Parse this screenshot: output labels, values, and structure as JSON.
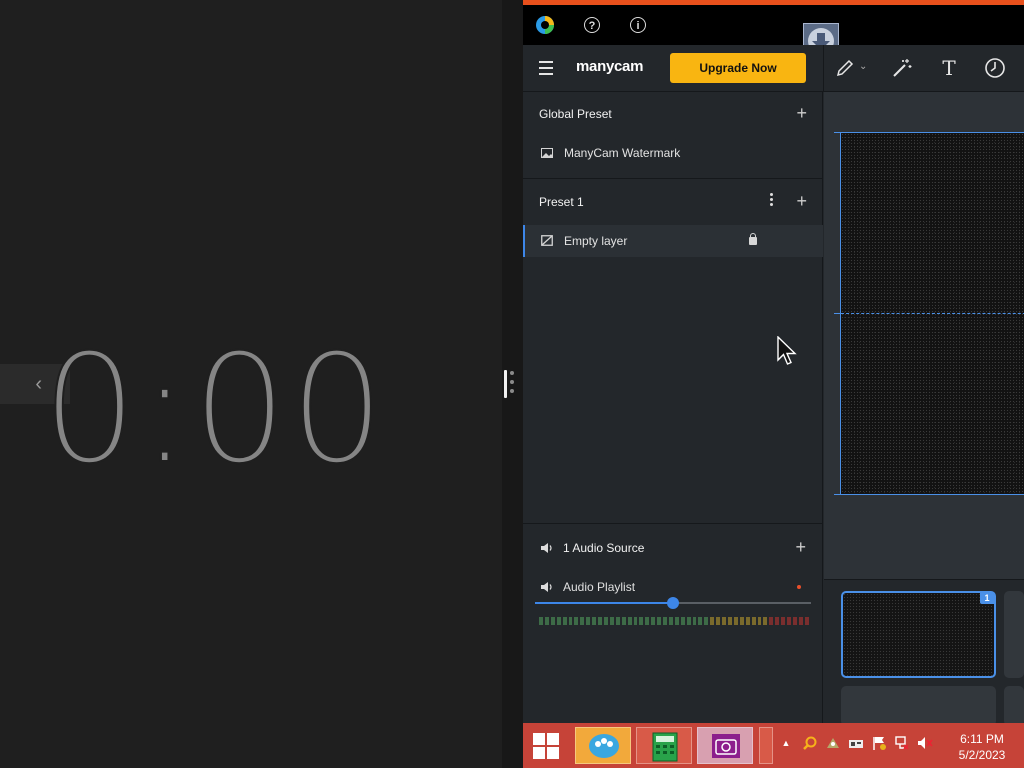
{
  "clock": {
    "time": "0:00",
    "back_icon": "chevron-left-icon"
  },
  "manycam": {
    "titlebar": {
      "logo_icon": "manycam-logo-icon",
      "help_icon": "help-circle-icon",
      "info_icon": "info-circle-icon",
      "help_glyph": "?",
      "info_glyph": "i"
    },
    "toolbar": {
      "brand": "manycam",
      "upgrade_label": "Upgrade Now",
      "tools": [
        "pencil-icon",
        "magic-wand-icon",
        "text-icon",
        "timer-icon"
      ],
      "text_tool_glyph": "T"
    },
    "layers": {
      "global_preset": {
        "title": "Global Preset",
        "items": [
          {
            "label": "ManyCam Watermark",
            "icon": "image-icon"
          }
        ]
      },
      "preset1": {
        "title": "Preset 1",
        "items": [
          {
            "label": "Empty layer",
            "icon": "empty-layer-icon",
            "locked": true
          }
        ]
      }
    },
    "audio": {
      "title": "1 Audio Source",
      "items": [
        {
          "label": "Audio Playlist",
          "volume": 0.5
        }
      ]
    },
    "preview": {
      "thumbnail_badge": "1"
    },
    "accent_color": "#3d86e8",
    "upgrade_color": "#f9b511"
  },
  "taskbar": {
    "apps": [
      "windows-start-icon",
      "meeting-app-icon",
      "calculator-icon",
      "camera-app-icon"
    ],
    "tray_icons": [
      "show-hidden-icons-chevron",
      "search-icon",
      "app-tray-icon",
      "network-card-icon",
      "action-center-flag-icon",
      "network-icon",
      "volume-muted-icon"
    ],
    "time": "6:11 PM",
    "date": "5/2/2023",
    "color": "#c64338"
  }
}
